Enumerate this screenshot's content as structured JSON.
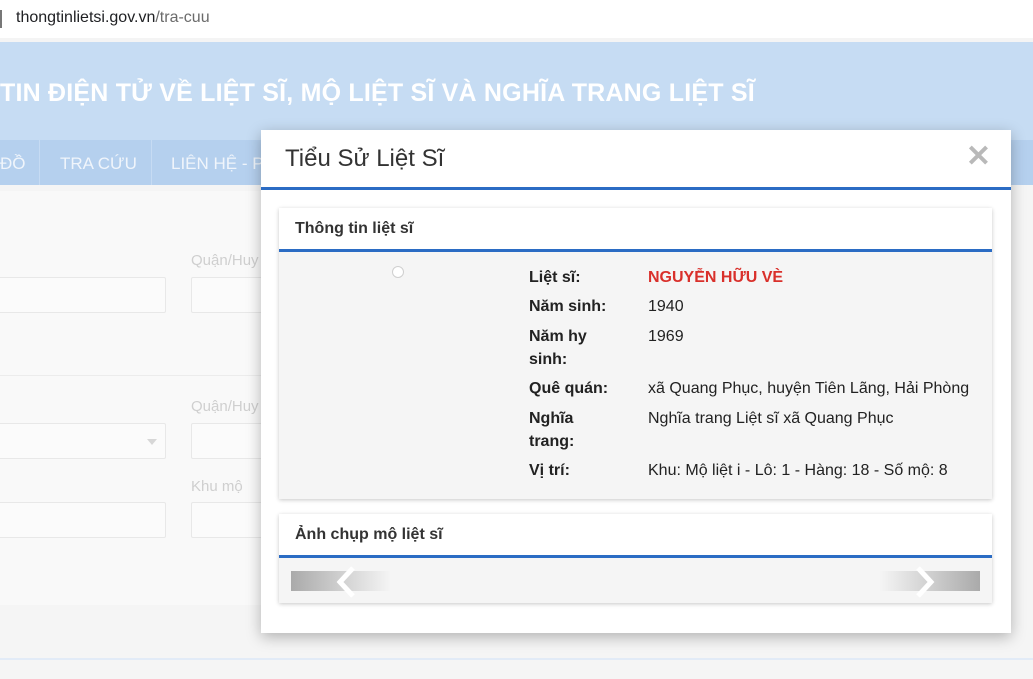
{
  "browser": {
    "url_host": "thongtinlietsi.gov.vn",
    "url_path": "/tra-cuu"
  },
  "site": {
    "title": "TIN ĐIỆN TỬ VỀ LIỆT SĨ, MỘ LIỆT SĨ VÀ NGHĨA TRANG LIỆT SĨ",
    "nav": [
      "ĐỒ",
      "TRA CỨU",
      "LIÊN HỆ - P"
    ]
  },
  "form": {
    "district_label_1": "Quận/Huy",
    "district_label_2": "Quận/Huy",
    "grave_area_label": "Khu mộ"
  },
  "modal": {
    "title": "Tiểu Sử Liệt Sĩ",
    "close_symbol": "✕",
    "info_section_title": "Thông tin liệt sĩ",
    "photo_section_title": "Ảnh chụp mộ liệt sĩ",
    "fields": [
      {
        "label": "Liệt sĩ:",
        "value": "NGUYỄN HỮU VÈ"
      },
      {
        "label": "Năm sinh:",
        "value": "1940"
      },
      {
        "label": "Năm hy sinh:",
        "value": "1969"
      },
      {
        "label": "Quê quán:",
        "value": "xã Quang Phục, huyện Tiên Lãng, Hải Phòng"
      },
      {
        "label": "Nghĩa trang:",
        "value": "Nghĩa trang Liệt sĩ xã Quang Phục"
      },
      {
        "label": "Vị trí:",
        "value": "Khu: Mộ liệt i - Lô: 1 - Hàng: 18 - Số mộ: 8"
      }
    ],
    "slider": {
      "prev_icon": "chevron-left-icon",
      "next_icon": "chevron-right-icon"
    }
  },
  "colors": {
    "accent_blue": "#2b6cc4",
    "name_red": "#d9302b",
    "header_bg": "#bcd6f1",
    "nav_bg": "#a9c8ec"
  }
}
